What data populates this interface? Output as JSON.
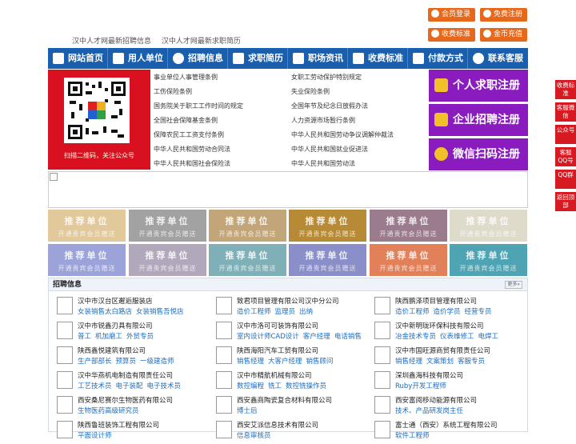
{
  "top": {
    "taglines": [
      "汉中人才网最新招聘信息",
      "汉中人才网最新求职简历"
    ],
    "buttons": {
      "login": "会员登录",
      "register": "免费注册",
      "fees": "收费标准",
      "recharge": "金币充值"
    }
  },
  "nav": [
    "网站首页",
    "用人单位",
    "招聘信息",
    "求职简历",
    "职场资讯",
    "收费标准",
    "付款方式",
    "联系客服"
  ],
  "qr": {
    "caption": "扫描二维码，关注公众号"
  },
  "laws": {
    "left": [
      "事业单位人事管理条例",
      "工伤保险条例",
      "国务院关于职工工作时间的规定",
      "全国社会保障基金条例",
      "保障农民工工资支付条例",
      "中华人民共和国劳动合同法",
      "中华人民共和国社会保险法"
    ],
    "right": [
      "女职工劳动保护特别规定",
      "失业保险条例",
      "全国年节及纪念日放假办法",
      "人力资源市场暂行条例",
      "中华人民共和国劳动争议调解仲裁法",
      "中华人民共和国就业促进法",
      "中华人民共和国劳动法"
    ]
  },
  "register": [
    "个人求职注册",
    "企业招聘注册",
    "微信扫码注册"
  ],
  "recommend": {
    "title": "推荐单位",
    "sub": "开通贵宾会员赠送",
    "colors": [
      "#e1c99b",
      "#a2a2a2",
      "#c2a67a",
      "#b78a35",
      "#9b7c8e",
      "#dedbcb",
      "#9ba3d9",
      "#b1a8bc",
      "#7fb0b8",
      "#8a8ec9",
      "#e2805a",
      "#4fa4b4"
    ]
  },
  "jobs": {
    "title": "招聘信息",
    "more": "更多»",
    "companies": [
      {
        "name": "汉中市汉台区邂逅服装店",
        "jobs": [
          "女装销售太白路店",
          "女装销售吾悦店"
        ]
      },
      {
        "name": "致君项目管理有限公司汉中分公司",
        "jobs": [
          "造价工程师",
          "监理员",
          "出纳"
        ]
      },
      {
        "name": "陕西鹏泽项目管理有限公司",
        "jobs": [
          "造价工程师",
          "造价学员",
          "经营专员"
        ]
      },
      {
        "name": "汉中市锐鑫刃具有限公司",
        "jobs": [
          "普工",
          "机加磨工",
          "外贸专员"
        ]
      },
      {
        "name": "汉中市洛可可装饰有限公司",
        "jobs": [
          "室内设计师CAD设计",
          "客户经理",
          "电话销售"
        ]
      },
      {
        "name": "汉中新明珑环保科技有限公司",
        "jobs": [
          "冶金技术专员",
          "仪表维修工",
          "电焊工"
        ]
      },
      {
        "name": "陕西鑫悦建筑有限公司",
        "jobs": [
          "生产部部长",
          "预算员",
          "一级建造师"
        ]
      },
      {
        "name": "陕西海阳汽车工贸有限公司",
        "jobs": [
          "销售经理",
          "大客户经理",
          "销售顾问"
        ]
      },
      {
        "name": "汉中市国旺源商贸有限责任公司",
        "jobs": [
          "销售经理",
          "文案策划",
          "客服专员"
        ]
      },
      {
        "name": "汉中华燕机电制造有限责任公司",
        "jobs": [
          "工艺技术员",
          "电子装配",
          "电子技术员"
        ]
      },
      {
        "name": "汉中市精航机械有限公司",
        "jobs": [
          "数控编程",
          "铣工",
          "数控铣操作员"
        ]
      },
      {
        "name": "深圳鑫海科技有限公司",
        "jobs": [
          "Ruby开发工程师"
        ]
      },
      {
        "name": "西安桑尼赛尔生物医药有限公司",
        "jobs": [
          "生物医药高级研究员"
        ]
      },
      {
        "name": "西安鑫商陶瓷复合材料有限公司",
        "jobs": [
          "博士后"
        ]
      },
      {
        "name": "西安富阅移动能源有限公司",
        "jobs": [
          "技术、产品研发岗主任"
        ]
      },
      {
        "name": "陕西鲁班装饰工程有限公司",
        "jobs": [
          "平面设计师"
        ]
      },
      {
        "name": "西安艾派信息技术有限公司",
        "jobs": [
          "信息审核员"
        ]
      },
      {
        "name": "富士通（西安）系统工程有限公司",
        "jobs": [
          "软件工程师"
        ]
      }
    ]
  },
  "side": [
    {
      "label": "收费标准"
    },
    {
      "label": "客服微信"
    },
    {
      "label": "公众号"
    },
    {
      "label": "客服QQ号"
    },
    {
      "label": "QQ群"
    },
    {
      "label": "返回顶部"
    }
  ]
}
